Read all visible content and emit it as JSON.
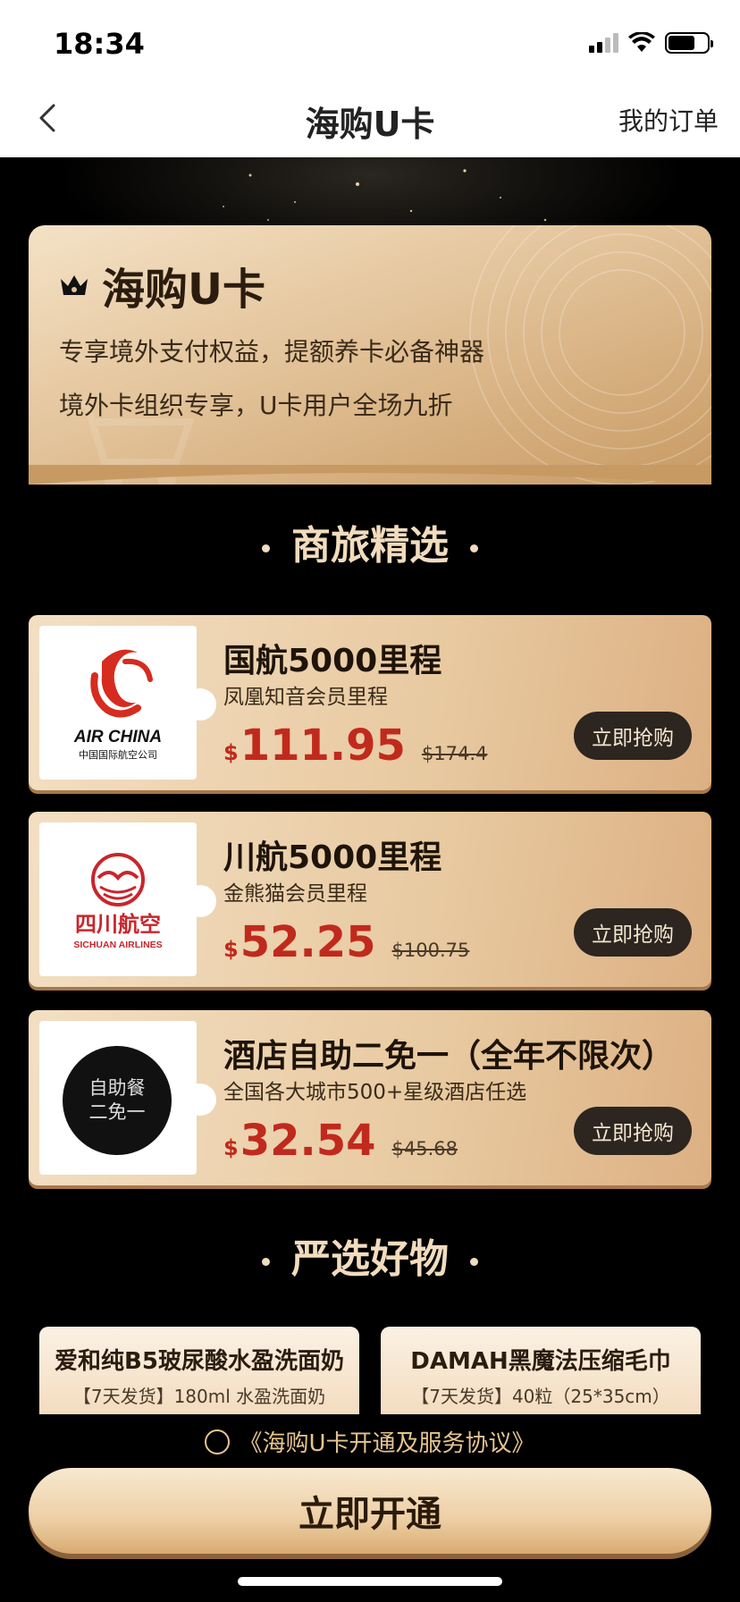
{
  "status_bar": {
    "time": "18:34"
  },
  "nav": {
    "title": "海购U卡",
    "orders_label": "我的订单"
  },
  "hero": {
    "title": "海购U卡",
    "line1": "专享境外支付权益，提额养卡必备神器",
    "line2": "境外卡组织专享，U卡用户全场九折"
  },
  "sections": {
    "business_travel": "商旅精选",
    "selected_goods": "严选好物"
  },
  "products": [
    {
      "name": "国航5000里程",
      "desc": "凤凰知音会员里程",
      "currency": "$",
      "price": "111.95",
      "original_price": "$174.4",
      "buy_label": "立即抢购",
      "logo_text": "AIR CHINA",
      "logo_subtext": "中国国际航空公司"
    },
    {
      "name": "川航5000里程",
      "desc": "金熊猫会员里程",
      "currency": "$",
      "price": "52.25",
      "original_price": "$100.75",
      "buy_label": "立即抢购",
      "logo_text": "四川航空",
      "logo_subtext": "SICHUAN AIRLINES"
    },
    {
      "name": "酒店自助二免一（全年不限次）",
      "desc": "全国各大城市500+星级酒店任选",
      "currency": "$",
      "price": "32.54",
      "original_price": "$45.68",
      "buy_label": "立即抢购",
      "logo_text_line1": "自助餐",
      "logo_text_line2": "二免一"
    }
  ],
  "goods": [
    {
      "name": "爱和纯B5玻尿酸水盈洗面奶",
      "desc": "【7天发货】180ml 水盈洗面奶"
    },
    {
      "name": "DAMAH黑魔法压缩毛巾",
      "desc": "【7天发货】40粒（25*35cm）"
    }
  ],
  "agreement": {
    "text": "《海购U卡开通及服务协议》"
  },
  "cta": {
    "label": "立即开通"
  },
  "colors": {
    "gold": "#e5c48f",
    "price_red": "#c02a1d",
    "button_dark": "#2c2520"
  }
}
